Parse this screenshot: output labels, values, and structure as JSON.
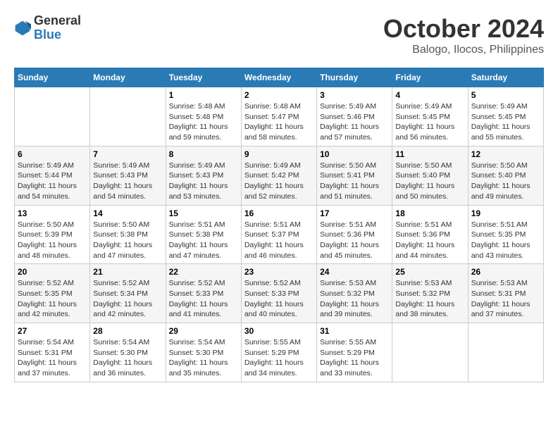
{
  "logo": {
    "line1": "General",
    "line2": "Blue"
  },
  "title": "October 2024",
  "subtitle": "Balogo, Ilocos, Philippines",
  "headers": [
    "Sunday",
    "Monday",
    "Tuesday",
    "Wednesday",
    "Thursday",
    "Friday",
    "Saturday"
  ],
  "weeks": [
    [
      {
        "day": "",
        "info": ""
      },
      {
        "day": "",
        "info": ""
      },
      {
        "day": "1",
        "info": "Sunrise: 5:48 AM\nSunset: 5:48 PM\nDaylight: 11 hours and 59 minutes."
      },
      {
        "day": "2",
        "info": "Sunrise: 5:48 AM\nSunset: 5:47 PM\nDaylight: 11 hours and 58 minutes."
      },
      {
        "day": "3",
        "info": "Sunrise: 5:49 AM\nSunset: 5:46 PM\nDaylight: 11 hours and 57 minutes."
      },
      {
        "day": "4",
        "info": "Sunrise: 5:49 AM\nSunset: 5:45 PM\nDaylight: 11 hours and 56 minutes."
      },
      {
        "day": "5",
        "info": "Sunrise: 5:49 AM\nSunset: 5:45 PM\nDaylight: 11 hours and 55 minutes."
      }
    ],
    [
      {
        "day": "6",
        "info": "Sunrise: 5:49 AM\nSunset: 5:44 PM\nDaylight: 11 hours and 54 minutes."
      },
      {
        "day": "7",
        "info": "Sunrise: 5:49 AM\nSunset: 5:43 PM\nDaylight: 11 hours and 54 minutes."
      },
      {
        "day": "8",
        "info": "Sunrise: 5:49 AM\nSunset: 5:43 PM\nDaylight: 11 hours and 53 minutes."
      },
      {
        "day": "9",
        "info": "Sunrise: 5:49 AM\nSunset: 5:42 PM\nDaylight: 11 hours and 52 minutes."
      },
      {
        "day": "10",
        "info": "Sunrise: 5:50 AM\nSunset: 5:41 PM\nDaylight: 11 hours and 51 minutes."
      },
      {
        "day": "11",
        "info": "Sunrise: 5:50 AM\nSunset: 5:40 PM\nDaylight: 11 hours and 50 minutes."
      },
      {
        "day": "12",
        "info": "Sunrise: 5:50 AM\nSunset: 5:40 PM\nDaylight: 11 hours and 49 minutes."
      }
    ],
    [
      {
        "day": "13",
        "info": "Sunrise: 5:50 AM\nSunset: 5:39 PM\nDaylight: 11 hours and 48 minutes."
      },
      {
        "day": "14",
        "info": "Sunrise: 5:50 AM\nSunset: 5:38 PM\nDaylight: 11 hours and 47 minutes."
      },
      {
        "day": "15",
        "info": "Sunrise: 5:51 AM\nSunset: 5:38 PM\nDaylight: 11 hours and 47 minutes."
      },
      {
        "day": "16",
        "info": "Sunrise: 5:51 AM\nSunset: 5:37 PM\nDaylight: 11 hours and 46 minutes."
      },
      {
        "day": "17",
        "info": "Sunrise: 5:51 AM\nSunset: 5:36 PM\nDaylight: 11 hours and 45 minutes."
      },
      {
        "day": "18",
        "info": "Sunrise: 5:51 AM\nSunset: 5:36 PM\nDaylight: 11 hours and 44 minutes."
      },
      {
        "day": "19",
        "info": "Sunrise: 5:51 AM\nSunset: 5:35 PM\nDaylight: 11 hours and 43 minutes."
      }
    ],
    [
      {
        "day": "20",
        "info": "Sunrise: 5:52 AM\nSunset: 5:35 PM\nDaylight: 11 hours and 42 minutes."
      },
      {
        "day": "21",
        "info": "Sunrise: 5:52 AM\nSunset: 5:34 PM\nDaylight: 11 hours and 42 minutes."
      },
      {
        "day": "22",
        "info": "Sunrise: 5:52 AM\nSunset: 5:33 PM\nDaylight: 11 hours and 41 minutes."
      },
      {
        "day": "23",
        "info": "Sunrise: 5:52 AM\nSunset: 5:33 PM\nDaylight: 11 hours and 40 minutes."
      },
      {
        "day": "24",
        "info": "Sunrise: 5:53 AM\nSunset: 5:32 PM\nDaylight: 11 hours and 39 minutes."
      },
      {
        "day": "25",
        "info": "Sunrise: 5:53 AM\nSunset: 5:32 PM\nDaylight: 11 hours and 38 minutes."
      },
      {
        "day": "26",
        "info": "Sunrise: 5:53 AM\nSunset: 5:31 PM\nDaylight: 11 hours and 37 minutes."
      }
    ],
    [
      {
        "day": "27",
        "info": "Sunrise: 5:54 AM\nSunset: 5:31 PM\nDaylight: 11 hours and 37 minutes."
      },
      {
        "day": "28",
        "info": "Sunrise: 5:54 AM\nSunset: 5:30 PM\nDaylight: 11 hours and 36 minutes."
      },
      {
        "day": "29",
        "info": "Sunrise: 5:54 AM\nSunset: 5:30 PM\nDaylight: 11 hours and 35 minutes."
      },
      {
        "day": "30",
        "info": "Sunrise: 5:55 AM\nSunset: 5:29 PM\nDaylight: 11 hours and 34 minutes."
      },
      {
        "day": "31",
        "info": "Sunrise: 5:55 AM\nSunset: 5:29 PM\nDaylight: 11 hours and 33 minutes."
      },
      {
        "day": "",
        "info": ""
      },
      {
        "day": "",
        "info": ""
      }
    ]
  ]
}
